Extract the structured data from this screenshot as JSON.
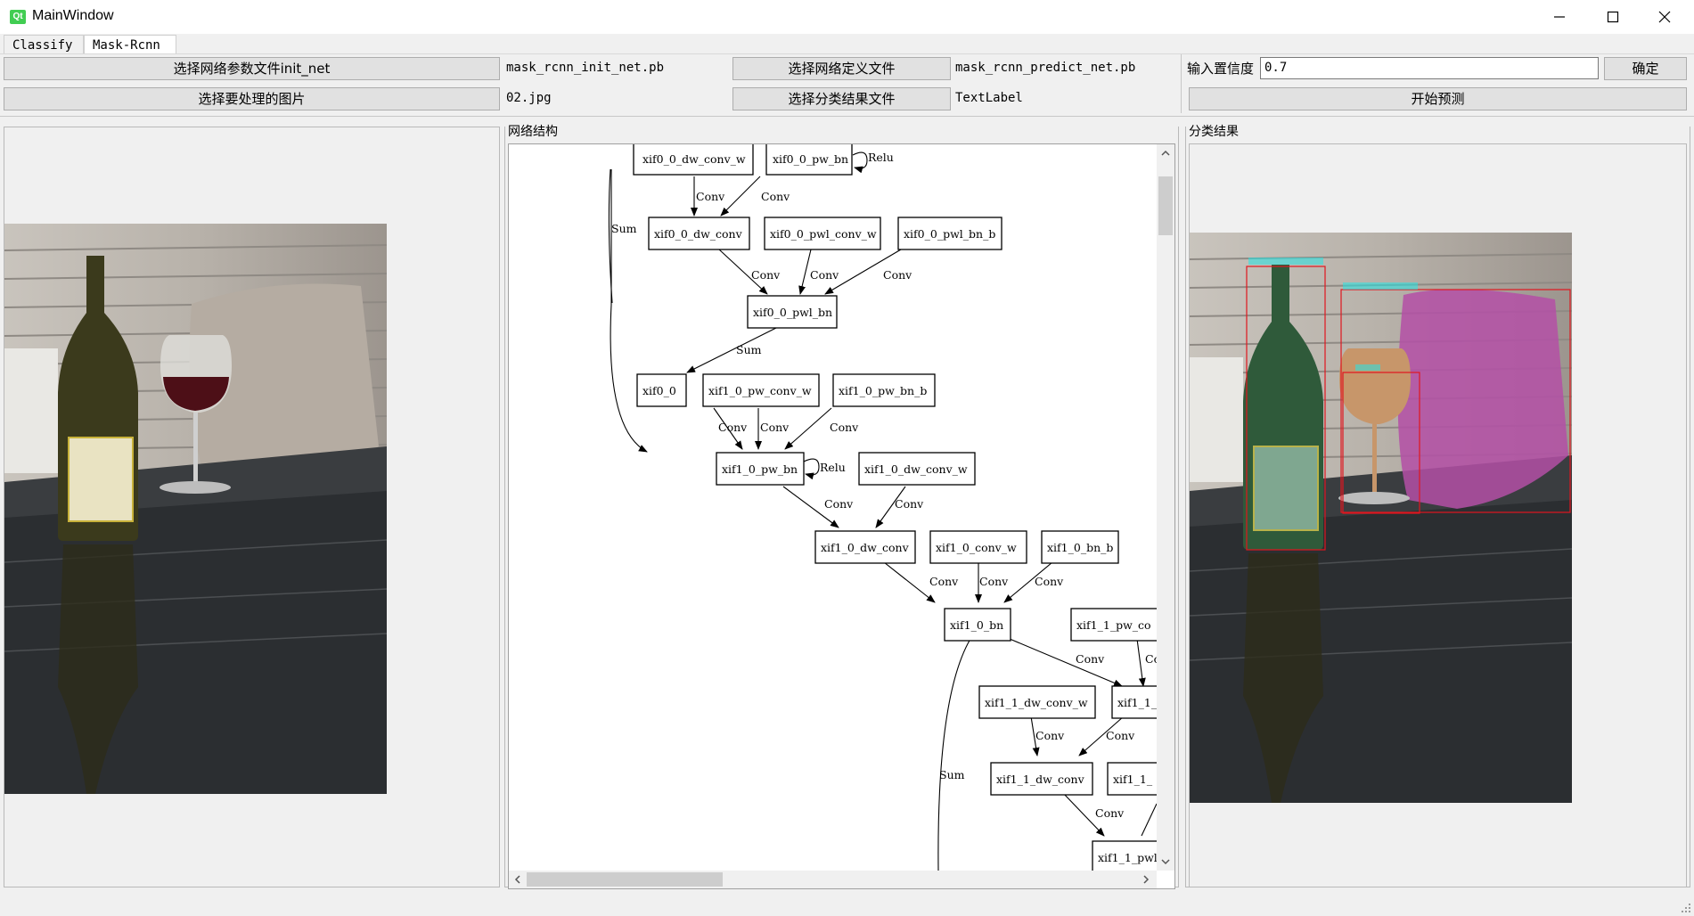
{
  "window": {
    "title": "MainWindow",
    "icon": "qt-logo-icon",
    "icon_text": "Qt"
  },
  "tabs": [
    {
      "label": "Classify",
      "active": false
    },
    {
      "label": "Mask-Rcnn",
      "active": true
    }
  ],
  "controls": {
    "init_net_button": "选择网络参数文件init_net",
    "init_net_value": "mask_rcnn_init_net.pb",
    "predict_net_button": "选择网络定义文件",
    "predict_net_value": "mask_rcnn_predict_net.pb",
    "confidence_label": "输入置信度",
    "confidence_value": "0.7",
    "confirm_button": "确定",
    "image_button": "选择要处理的图片",
    "image_value": "02.jpg",
    "result_file_button": "选择分类结果文件",
    "result_file_value": "TextLabel",
    "start_button": "开始预测"
  },
  "panels": {
    "network_title": "网络结构",
    "result_title": "分类结果"
  },
  "graph": {
    "nodes": [
      "xif0_0_dw_conv_w",
      "xif0_0_pw_bn",
      "xif0_0_dw_conv",
      "xif0_0_pwl_conv_w",
      "xif0_0_pwl_bn_b",
      "xif0_0_pwl_bn",
      "xif0_0",
      "xif1_0_pw_conv_w",
      "xif1_0_pw_bn_b",
      "xif1_0_pw_bn",
      "xif1_0_dw_conv_w",
      "xif1_0_dw_conv",
      "xif1_0_conv_w",
      "xif1_0_bn_b",
      "xif1_0_bn",
      "xif1_1_pw_co",
      "xif1_1_dw_conv_w",
      "xif1_1_",
      "xif1_1_dw_conv",
      "xif1_1_",
      "xif1_1_pwl"
    ],
    "edge_labels": {
      "conv": "Conv",
      "relu": "Relu",
      "sum": "Sum",
      "conv_cut": "Co"
    }
  },
  "detections": [
    {
      "label": "",
      "color": "#e0161e"
    },
    {
      "label": "",
      "color": "#e0161e"
    },
    {
      "label": "",
      "color": "#e0161e"
    }
  ],
  "icons": {
    "minimize": "minimize-icon",
    "maximize": "maximize-icon",
    "close": "close-icon",
    "scroll_up": "chevron-up-icon",
    "scroll_down": "chevron-down-icon",
    "scroll_left": "chevron-left-icon",
    "scroll_right": "chevron-right-icon",
    "grip": "size-grip-icon"
  }
}
